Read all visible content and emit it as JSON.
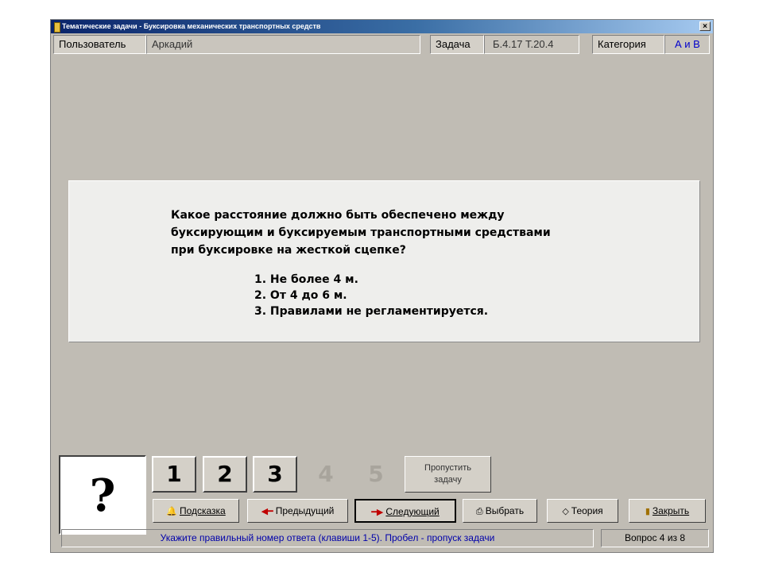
{
  "window": {
    "title": "Тематические задачи - Буксировка механических транспортных средств",
    "close_label": "×"
  },
  "infobar": {
    "user_label": "Пользователь",
    "user_value": "Аркадий",
    "task_label": "Задача",
    "task_value": "Б.4.17  Т.20.4",
    "category_label": "Категория",
    "category_value": "А и В"
  },
  "question": {
    "lines": [
      "Какое расстояние должно быть обеспечено между",
      "буксирующим и буксируемым транспортными средствами",
      "при буксировке на жесткой сцепке?"
    ],
    "answers": [
      "1. Не более 4 м.",
      "2. От 4 до 6 м.",
      "3. Правилами не регламентируется."
    ]
  },
  "answer_panel": {
    "placeholder": "?",
    "numbers": [
      "1",
      "2",
      "3",
      "4",
      "5"
    ],
    "skip_line1": "Пропустить",
    "skip_line2": "задачу"
  },
  "actions": {
    "hint": "Подсказка",
    "prev": "Предыдущий",
    "next": "Следующий",
    "choose": "Выбрать",
    "theory": "Теория",
    "close": "Закрыть"
  },
  "status": {
    "message": "Укажите правильный номер ответа (клавиши 1-5). Пробел - пропуск задачи",
    "counter": "Вопрос 4 из 8"
  },
  "colors": {
    "titlebar": "#0a246a",
    "window_bg": "#c0bcb4",
    "status_text": "#0000aa",
    "category_value": "#0000cc"
  }
}
